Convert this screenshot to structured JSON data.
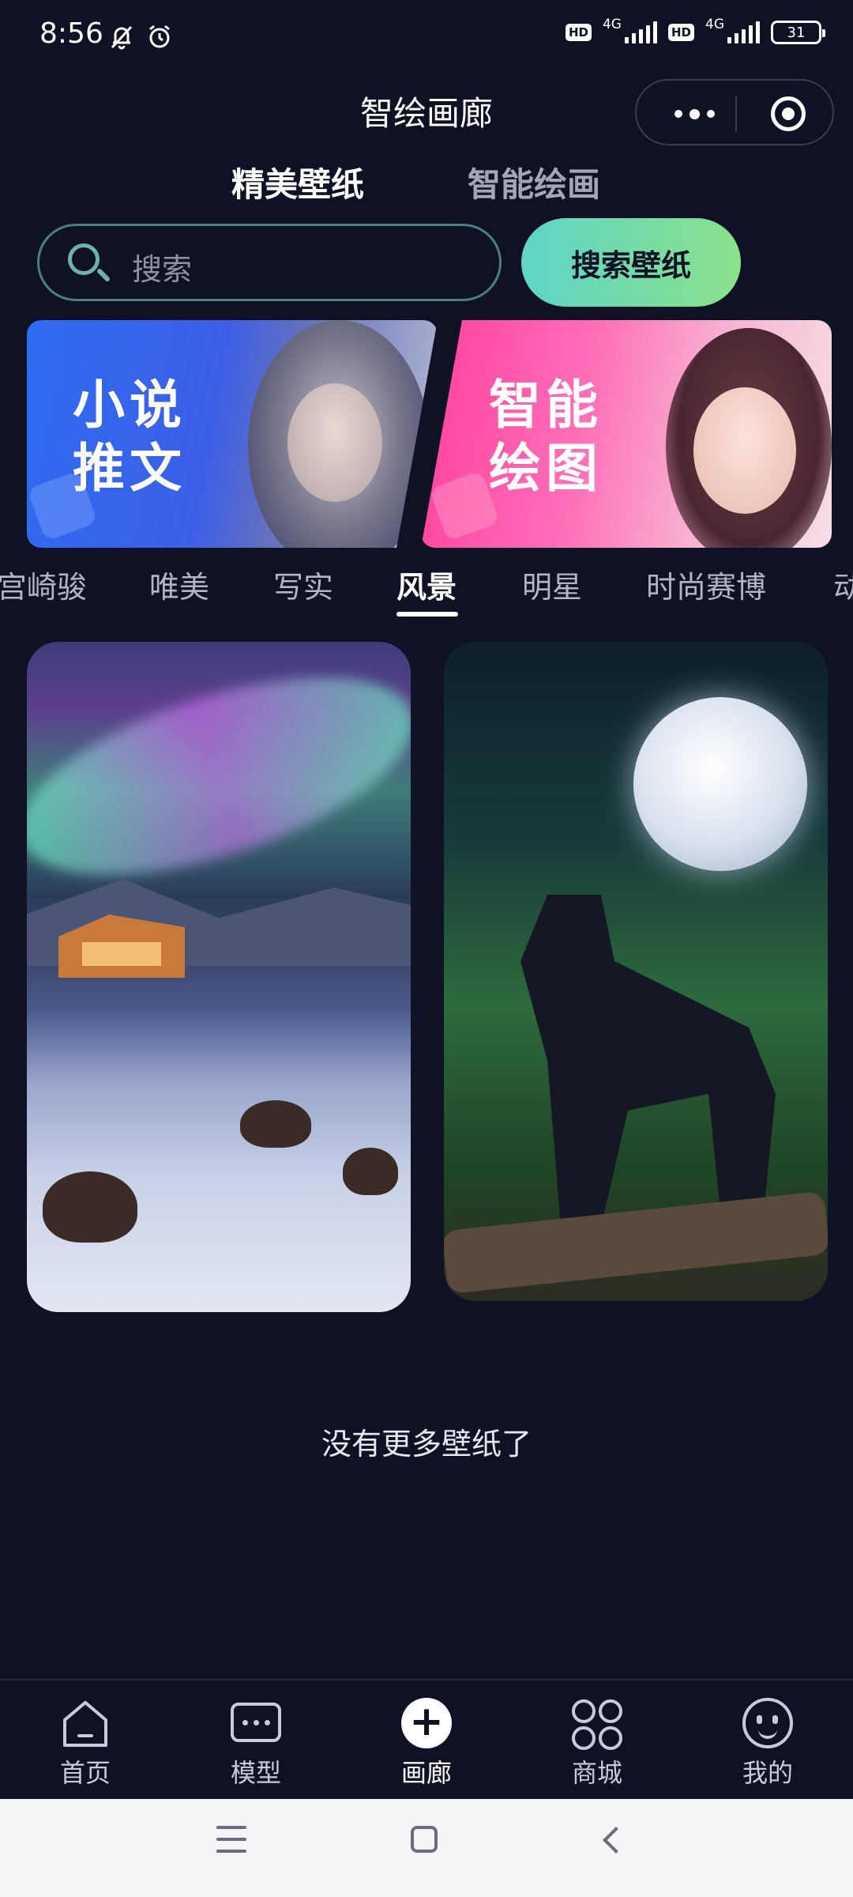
{
  "status_bar": {
    "time": "8:56",
    "hd1": "HD",
    "net1": "4G",
    "hd2": "HD",
    "net2": "4G",
    "battery": "31"
  },
  "header": {
    "title": "智绘画廊"
  },
  "top_tabs": {
    "wallpaper": "精美壁纸",
    "ai_draw": "智能绘画"
  },
  "search": {
    "placeholder": "搜索",
    "button": "搜索壁纸"
  },
  "banners": {
    "novel_line1": "小说",
    "novel_line2": "推文",
    "draw_line1": "智能",
    "draw_line2": "绘图"
  },
  "categories": [
    "宫崎骏",
    "唯美",
    "写实",
    "风景",
    "明星",
    "时尚赛博",
    "动"
  ],
  "active_category": "风景",
  "end_message": "没有更多壁纸了",
  "bottom_nav": {
    "home": "首页",
    "model": "模型",
    "gallery": "画廊",
    "shop": "商城",
    "mine": "我的"
  },
  "colors": {
    "background": "#0f1225",
    "accent_gradient_start": "#5ed5c8",
    "accent_gradient_end": "#8ae28a"
  }
}
